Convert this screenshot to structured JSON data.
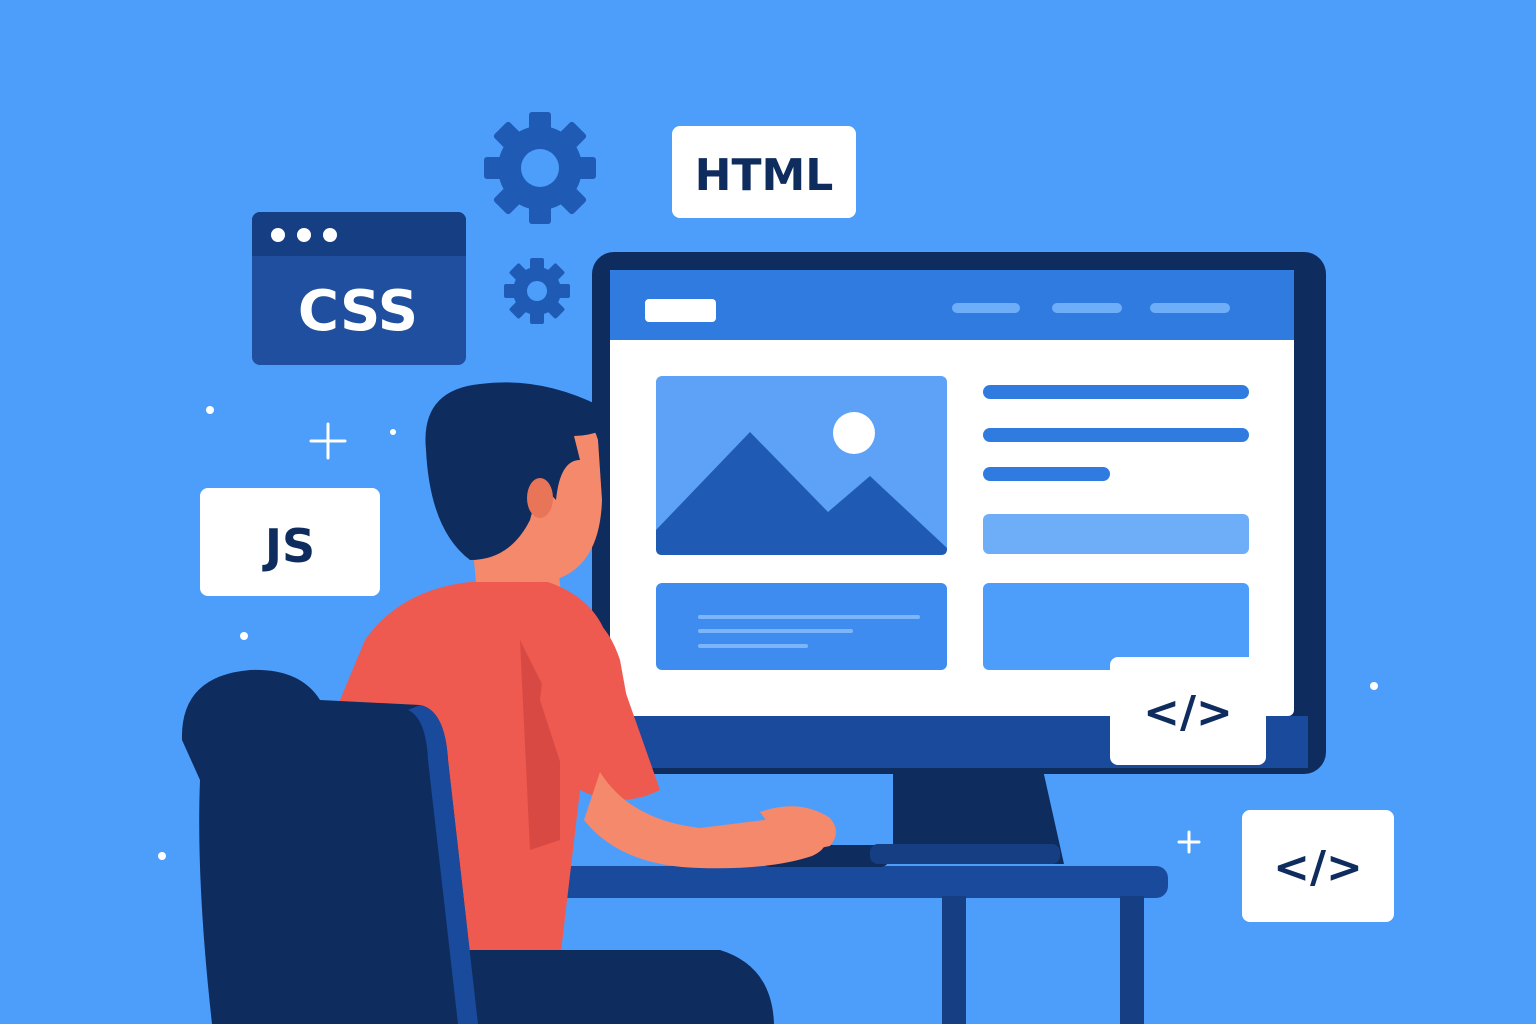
{
  "tags": {
    "html": "HTML",
    "css": "CSS",
    "js": "JS",
    "code_front": "</>",
    "code_side": "</>"
  },
  "colors": {
    "background": "#4d9efa",
    "navy": "#0f2c5e",
    "brand_blue": "#1f5bb5",
    "accent_blue": "#2f7be0",
    "screen_white": "#ffffff",
    "shirt_red": "#ee5a4f",
    "skin": "#f4896b"
  },
  "icons": [
    "gear-icon-large",
    "gear-icon-small",
    "sparkle-plus-icon",
    "mountain-image-icon",
    "sun-icon"
  ]
}
